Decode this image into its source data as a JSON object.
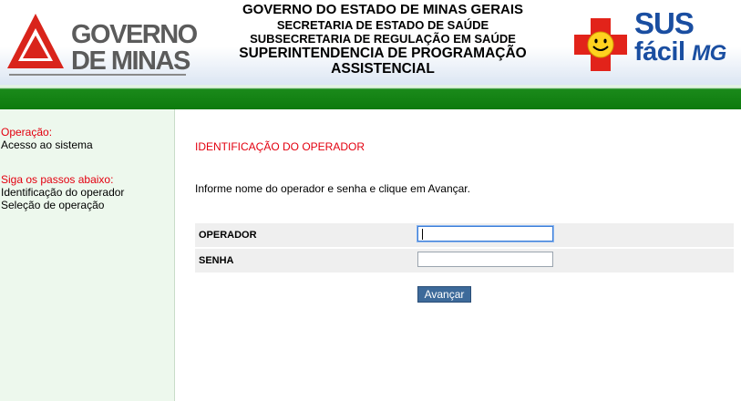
{
  "header": {
    "left_logo": {
      "line1": "GOVERNO",
      "line2": "DE MINAS"
    },
    "titles": [
      "GOVERNO DO ESTADO DE MINAS GERAIS",
      "SECRETARIA DE ESTADO DE SAÚDE",
      "SUBSECRETARIA DE REGULAÇÃO EM SAÚDE",
      "SUPERINTENDENCIA DE PROGRAMAÇÃO",
      "ASSISTENCIAL"
    ],
    "right_logo": {
      "line1": "SUS",
      "line2_a": "fácil",
      "line2_b": "MG"
    }
  },
  "sidebar": {
    "operation_title": "Operação:",
    "operation_value": "Acesso ao sistema",
    "steps_title": "Siga os passos abaixo:",
    "steps": [
      "Identificação do operador",
      "Seleção de operação"
    ]
  },
  "main": {
    "heading": "IDENTIFICAÇÃO DO OPERADOR",
    "instruction": "Informe nome do operador e senha e clique em Avançar.",
    "fields": [
      {
        "label": "OPERADOR",
        "value": ""
      },
      {
        "label": "SENHA",
        "value": ""
      }
    ],
    "submit_label": "Avançar"
  },
  "colors": {
    "accent_red": "#e3000f",
    "header_green": "#0d7a0d",
    "button_blue": "#3d6a9a",
    "sidebar_bg": "#edf8ed",
    "sus_blue": "#1a4ea1"
  }
}
